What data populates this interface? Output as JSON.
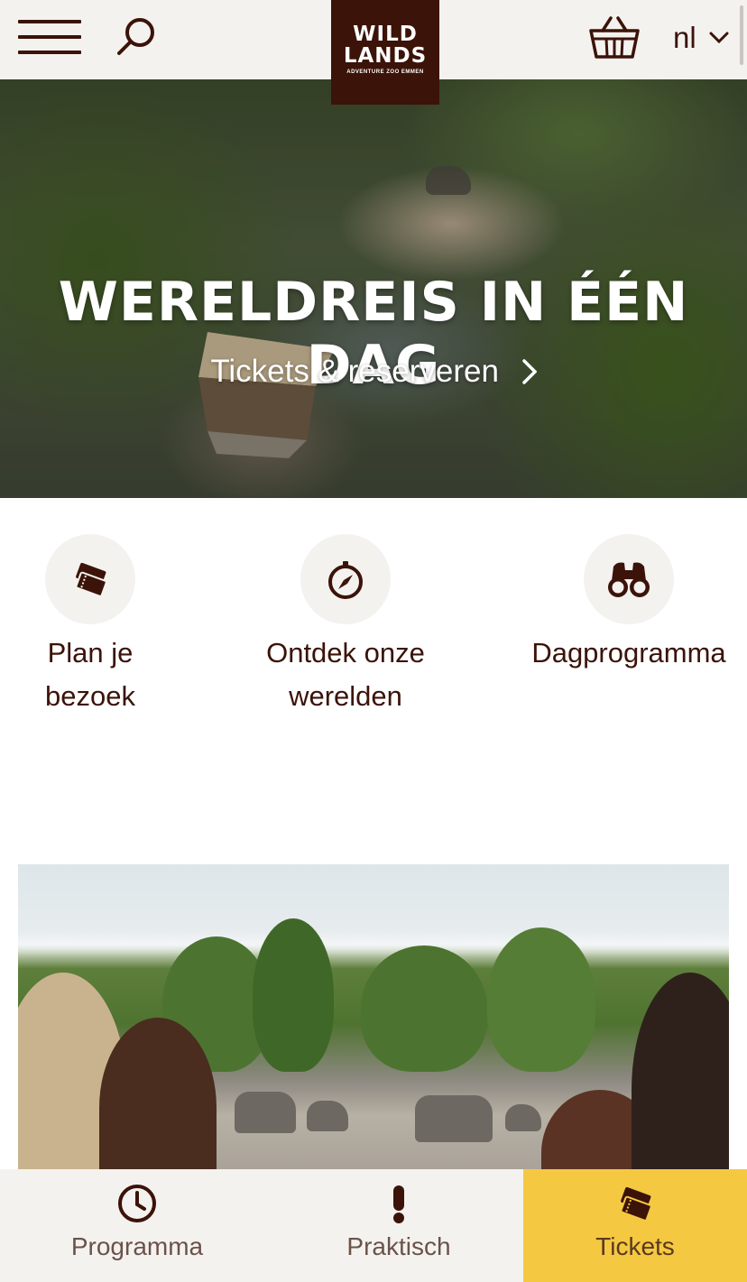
{
  "header": {
    "logo_line1": "WILD",
    "logo_line2": "LANDS",
    "logo_tagline": "ADVENTURE ZOO EMMEN",
    "language": "nl"
  },
  "hero": {
    "title": "WERELDREIS IN ÉÉN DAG",
    "link_label": "Tickets & reserveren"
  },
  "quick_links": [
    {
      "label_line1": "Plan je",
      "label_line2": "bezoek",
      "icon": "tickets-icon"
    },
    {
      "label_line1": "Ontdek onze",
      "label_line2": "werelden",
      "icon": "compass-icon"
    },
    {
      "label_line1": "Dagprogramma",
      "label_line2": "",
      "icon": "binoculars-icon"
    }
  ],
  "bottom_nav": [
    {
      "label": "Programma",
      "icon": "clock-icon",
      "active": false
    },
    {
      "label": "Praktisch",
      "icon": "exclamation-icon",
      "active": false
    },
    {
      "label": "Tickets",
      "icon": "tickets-icon",
      "active": true
    }
  ],
  "colors": {
    "brand_brown": "#3b1308",
    "header_bg": "#f4f2ef",
    "tickets_yellow": "#f5c842"
  }
}
